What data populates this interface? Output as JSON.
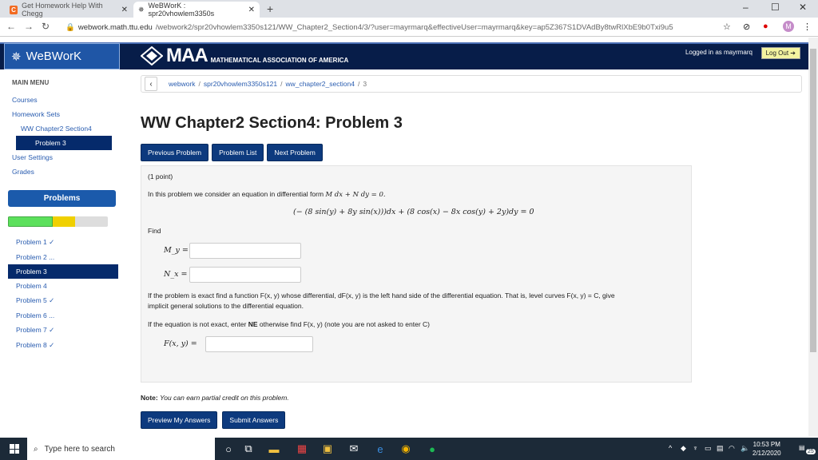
{
  "browser": {
    "tabs": [
      {
        "label": "Get Homework Help With Chegg"
      },
      {
        "label": "WeBWorK : spr20vhowlem3350s"
      }
    ],
    "url_host": "webwork.math.ttu.edu",
    "url_path": "/webwork2/spr20vhowlem3350s121/WW_Chapter2_Section4/3/?user=mayrmarq&effectiveUser=mayrmarq&key=ap5Z367S1DVAdBy8twRlXbE9b0Txi9u5",
    "profile_letter": "M"
  },
  "header": {
    "logo_text": "WeBWorK",
    "maa_big": "MAA",
    "maa_small": "MATHEMATICAL ASSOCIATION OF AMERICA",
    "logged_in": "Logged in as mayrmarq",
    "logout": "Log Out"
  },
  "sidebar": {
    "menu_heading": "MAIN MENU",
    "courses": "Courses",
    "homework_sets": "Homework Sets",
    "set_name": "WW Chapter2 Section4",
    "current_problem": "Problem 3",
    "user_settings": "User Settings",
    "grades": "Grades",
    "problems_heading": "Problems",
    "progress": {
      "correct": 0.45,
      "partial": 0.22
    },
    "problems": [
      {
        "label": "Problem 1 ✓"
      },
      {
        "label": "Problem 2 ..."
      },
      {
        "label": "Problem 3"
      },
      {
        "label": "Problem 4"
      },
      {
        "label": "Problem 5 ✓"
      },
      {
        "label": "Problem 6 ..."
      },
      {
        "label": "Problem 7 ✓"
      },
      {
        "label": "Problem 8 ✓"
      }
    ]
  },
  "breadcrumb": {
    "root": "webwork",
    "course": "spr20vhowlem3350s121",
    "set": "ww_chapter2_section4",
    "problem": "3"
  },
  "main": {
    "title": "WW Chapter2 Section4: Problem 3",
    "prev": "Previous Problem",
    "list": "Problem List",
    "next": "Next Problem",
    "points": "(1 point)",
    "intro": "In this problem we consider an equation in differential form",
    "intro_math": "M dx + N dy = 0.",
    "equation": "(− (8 sin(y) + 8y sin(x)))dx + (8 cos(x) − 8x cos(y) + 2y)dy = 0",
    "find": "Find",
    "my_label": "M_y =",
    "nx_label": "N_x =",
    "exact_text_1": "If the problem is exact find a function F(x, y) whose differential, dF(x, y) is the left hand side of the differential equation. That is, level curves F(x, y) = C, give",
    "exact_text_2": "implicit general solutions to the differential equation.",
    "not_exact_1": "If the equation is not exact, enter",
    "not_exact_ne": "NE",
    "not_exact_2": "otherwise find F(x, y) (note you are not asked to enter C)",
    "f_label": "F(x, y) =",
    "note_label": "Note:",
    "note_text": "You can earn partial credit on this problem.",
    "preview": "Preview My Answers",
    "submit": "Submit Answers"
  },
  "taskbar": {
    "search_placeholder": "Type here to search",
    "time": "10:53 PM",
    "date": "2/12/2020",
    "notif": "25"
  }
}
